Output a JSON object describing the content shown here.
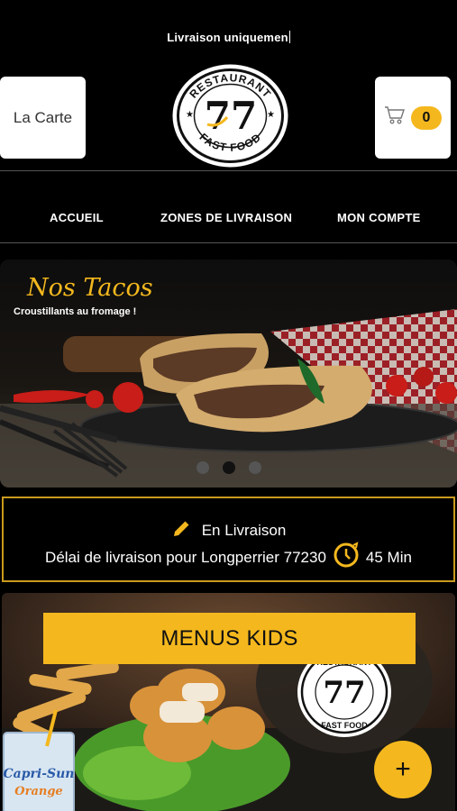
{
  "header": {
    "notice": "Livraison uniquemen",
    "carte_label": "La Carte",
    "cart_count": "0",
    "logo": {
      "top_text": "RESTAURANT",
      "bottom_text": "FAST FOOD",
      "mark": "77"
    }
  },
  "nav": {
    "items": [
      "ACCUEIL",
      "ZONES DE LIVRAISON",
      "MON COMPTE"
    ]
  },
  "slider": {
    "title": "Nos Tacos",
    "subtitle": "Croustillants au fromage !",
    "slide_count": 3,
    "active_index": 1
  },
  "delivery": {
    "mode": "En Livraison",
    "delay_text": "Délai de livraison pour Longperrier 77230",
    "delay_time": "45 Min"
  },
  "menu_card": {
    "title": "MENUS KIDS",
    "drink_label": "Capri-Sun",
    "drink_flavor": "Orange",
    "add_button": "+"
  },
  "colors": {
    "accent": "#f4b81e",
    "border_gold": "#c99a1c",
    "background": "#000000"
  }
}
